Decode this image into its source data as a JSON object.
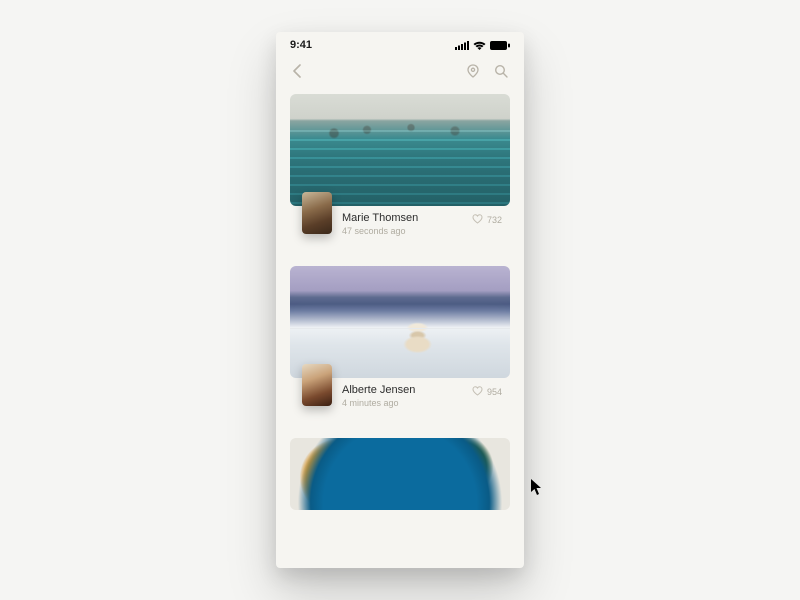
{
  "status": {
    "time": "9:41"
  },
  "feed": [
    {
      "author": "Marie Thomsen",
      "timestamp": "47 seconds ago",
      "likes": "732"
    },
    {
      "author": "Alberte Jensen",
      "timestamp": "4 minutes ago",
      "likes": "954"
    }
  ]
}
